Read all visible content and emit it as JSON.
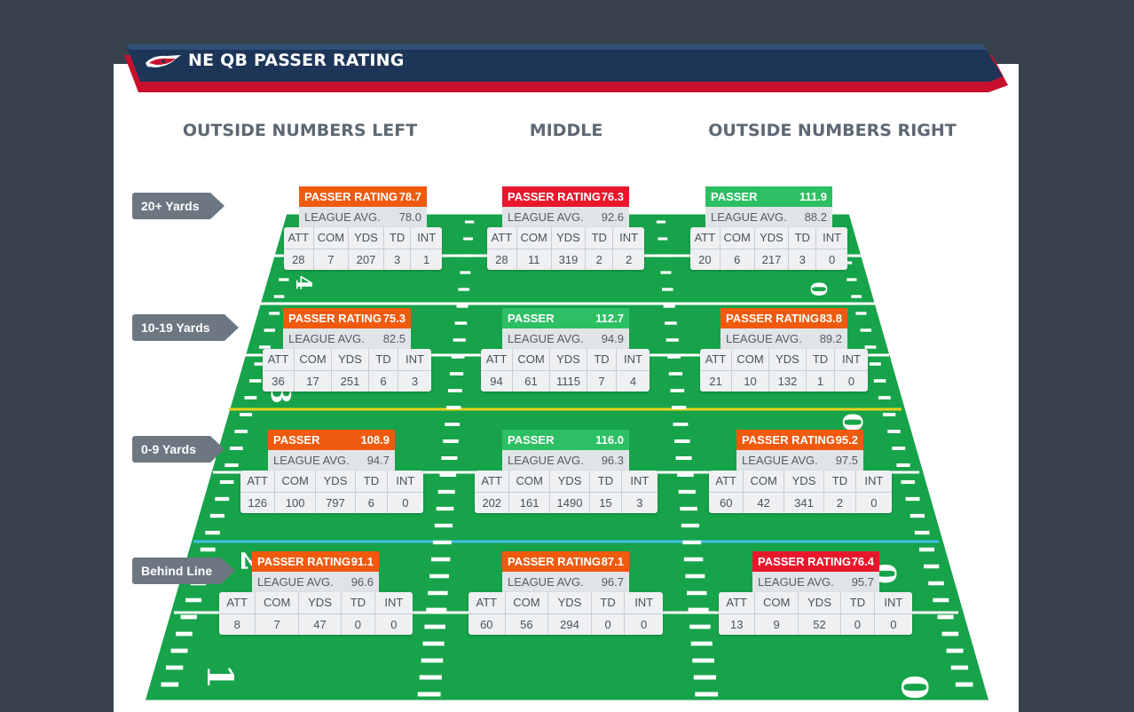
{
  "header": {
    "title": "NE QB PASSER RATING",
    "logo_icon": "patriots-logo-icon",
    "colors": {
      "navy": "#1c3352",
      "red": "#c8102e",
      "field": "#17a34a"
    }
  },
  "columns": [
    "OUTSIDE NUMBERS LEFT",
    "MIDDLE",
    "OUTSIDE NUMBERS RIGHT"
  ],
  "rows": [
    "20+ Yards",
    "10-19 Yards",
    "0-9 Yards",
    "Behind Line"
  ],
  "labels": {
    "rating": "PASSER RATING",
    "league": "LEAGUE AVG.",
    "att": "ATT",
    "com": "COM",
    "yds": "YDS",
    "td": "TD",
    "int": "INT"
  },
  "zones": [
    [
      {
        "rating": "78.7",
        "color": "orange",
        "league": "78.0",
        "att": "28",
        "com": "7",
        "yds": "207",
        "td": "3",
        "int": "1"
      },
      {
        "rating": "76.3",
        "color": "red",
        "league": "92.6",
        "att": "28",
        "com": "11",
        "yds": "319",
        "td": "2",
        "int": "2"
      },
      {
        "rating": "111.9",
        "color": "green",
        "league": "88.2",
        "att": "20",
        "com": "6",
        "yds": "217",
        "td": "3",
        "int": "0"
      }
    ],
    [
      {
        "rating": "75.3",
        "color": "orange",
        "league": "82.5",
        "att": "36",
        "com": "17",
        "yds": "251",
        "td": "6",
        "int": "3"
      },
      {
        "rating": "112.7",
        "color": "green",
        "league": "94.9",
        "att": "94",
        "com": "61",
        "yds": "1115",
        "td": "7",
        "int": "4"
      },
      {
        "rating": "83.8",
        "color": "orange",
        "league": "89.2",
        "att": "21",
        "com": "10",
        "yds": "132",
        "td": "1",
        "int": "0"
      }
    ],
    [
      {
        "rating": "108.9",
        "color": "orange",
        "league": "94.7",
        "att": "126",
        "com": "100",
        "yds": "797",
        "td": "6",
        "int": "0"
      },
      {
        "rating": "116.0",
        "color": "green",
        "league": "96.3",
        "att": "202",
        "com": "161",
        "yds": "1490",
        "td": "15",
        "int": "3"
      },
      {
        "rating": "95.2",
        "color": "orange",
        "league": "97.5",
        "att": "60",
        "com": "42",
        "yds": "341",
        "td": "2",
        "int": "0"
      }
    ],
    [
      {
        "rating": "91.1",
        "color": "orange",
        "league": "96.6",
        "att": "8",
        "com": "7",
        "yds": "47",
        "td": "0",
        "int": "0"
      },
      {
        "rating": "87.1",
        "color": "orange",
        "league": "96.7",
        "att": "60",
        "com": "56",
        "yds": "294",
        "td": "0",
        "int": "0"
      },
      {
        "rating": "76.4",
        "color": "red",
        "league": "95.7",
        "att": "13",
        "com": "9",
        "yds": "52",
        "td": "0",
        "int": "0"
      }
    ]
  ],
  "field_numbers": {
    "left": [
      "4",
      "3",
      "2",
      "1"
    ],
    "right": [
      "0",
      "0",
      "0",
      "0"
    ]
  }
}
